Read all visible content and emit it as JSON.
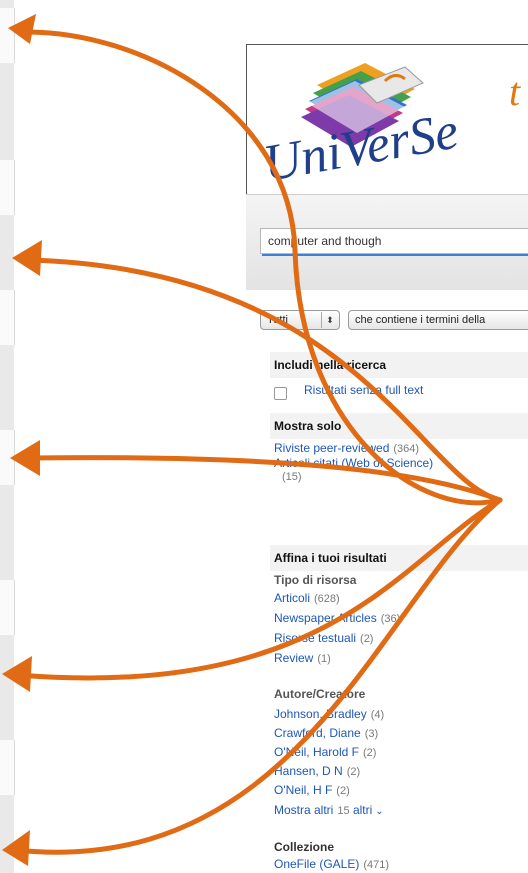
{
  "logo": {
    "text": "UniVerSe",
    "tail": "t"
  },
  "search": {
    "query": "computer and though"
  },
  "filters": {
    "scope": "Tutti",
    "scope_arrow": "⬍",
    "terms": "che contiene i termini della"
  },
  "facets": {
    "include": {
      "title": "Includi nella ricerca",
      "option": "Risultati senza full text"
    },
    "show_only": {
      "title": "Mostra solo",
      "items": [
        {
          "label": "Riviste peer-reviewed",
          "count": "(364)"
        },
        {
          "label": "Articoli citati (Web of Science)",
          "count": "(15)"
        }
      ]
    },
    "refine": {
      "title": "Affina i tuoi risultati",
      "resource_type": {
        "title": "Tipo di risorsa",
        "items": [
          {
            "label": "Articoli",
            "count": "(628)"
          },
          {
            "label": "Newspaper Articles",
            "count": "(36)"
          },
          {
            "label": "Risorse testuali",
            "count": "(2)"
          },
          {
            "label": "Review",
            "count": "(1)"
          }
        ]
      },
      "author": {
        "title": "Autore/Creatore",
        "items": [
          {
            "label": "Johnson, Bradley",
            "count": "(4)"
          },
          {
            "label": "Crawford, Diane",
            "count": "(3)"
          },
          {
            "label": "O'Neil, Harold F",
            "count": "(2)"
          },
          {
            "label": "Hansen, D N",
            "count": "(2)"
          },
          {
            "label": "O'Neil, H F",
            "count": "(2)"
          }
        ],
        "more_label": "Mostra altri",
        "more_count": "15",
        "more_suffix": "altri"
      },
      "collection": {
        "title": "Collezione",
        "items": [
          {
            "label": "OneFile (GALE)",
            "count": "(471)"
          }
        ]
      }
    }
  },
  "colors": {
    "arrow": "#e06b14",
    "link": "#1d57b6",
    "search_tab": "#3f7fd6"
  }
}
